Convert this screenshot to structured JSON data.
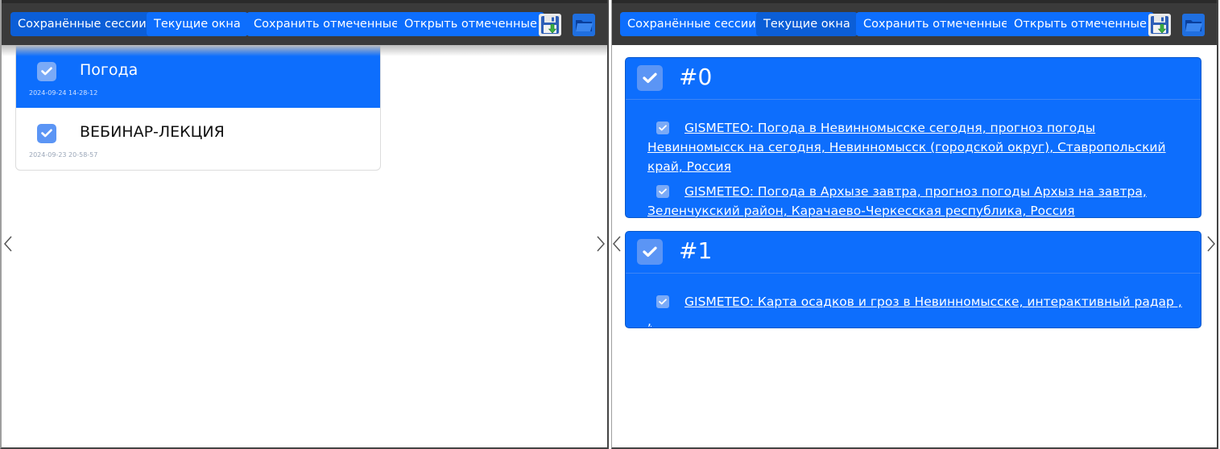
{
  "toolbar": {
    "saved_sessions": "Сохранённые сессии",
    "current_windows": "Текущие окна",
    "save_selected": "Сохранить отмеченные",
    "open_selected": "Открыть отмеченные",
    "save_icon": "floppy-disk-icon",
    "open_icon": "folder-open-icon"
  },
  "sessions": [
    {
      "title": "Погода",
      "date": "2024-09-24 14-28-12",
      "checked": true,
      "active": true
    },
    {
      "title": "ВЕБИНАР-ЛЕКЦИЯ",
      "date": "2024-09-23 20-58-57",
      "checked": true,
      "active": false
    }
  ],
  "windows": [
    {
      "title": "#0",
      "tabs": [
        {
          "text": "GISMETEO: Погода в Невинномысске сегодня, прогноз погоды Невинномысск на сегодня, Невинномысск (городской округ), Ставропольский край, Россия"
        },
        {
          "text": "GISMETEO: Погода в Архызе завтра, прогноз погоды Архыз на завтра, Зеленчукский район, Карачаево-Черкесская республика, Россия"
        }
      ]
    },
    {
      "title": "#1",
      "tabs": [
        {
          "text": "GISMETEO: Карта осадков и гроз в Невинномысске, интерактивный радар , ,"
        }
      ]
    }
  ],
  "colors": {
    "accent": "#0d6efd",
    "toolbar_bg": "#3a3a3a"
  }
}
